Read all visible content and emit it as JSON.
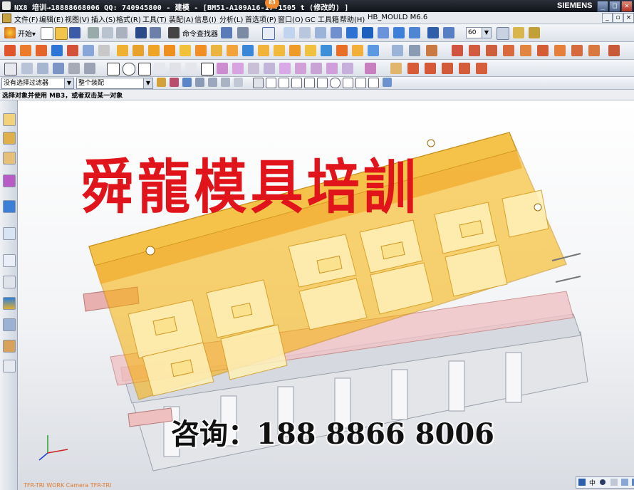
{
  "window": {
    "title": "NX8 培训→18888668006 QQ: 740945800 - 建模 - [BM51-A109A16-17-1505 t  (修改的) ]",
    "badge": "83",
    "brand": "SIEMENS",
    "buttons": [
      "_",
      "□",
      "×"
    ]
  },
  "menu": {
    "items": [
      "文件(F)",
      "编辑(E)",
      "视图(V)",
      "插入(S)",
      "格式(R)",
      "工具(T)",
      "装配(A)",
      "信息(I)",
      "分析(L)",
      "首选项(P)",
      "窗口(O)",
      "GC 工具箱",
      "帮助(H)",
      "HB_MOULD M6.6"
    ]
  },
  "toolbar": {
    "start_label": "开始▾",
    "command_finder_label": "命令查找器",
    "zoom_value": "60"
  },
  "selection": {
    "filter_value": "没有选择过滤器",
    "scope_value": "整个装配"
  },
  "cue_line": "选择对象并使用 MB3，或者双击某一对象",
  "viewport": {
    "watermark_text": "舜龍模具培訓",
    "contact_text": "咨询：188 8866 8006",
    "view_label": "TFR-TRI WORK Camera TFR-TRI"
  },
  "mini_toolbar": {
    "label": "中"
  },
  "colors": {
    "accent": "#e0141a",
    "plate": "#f7b000",
    "titlebar": "#1b1f27",
    "viewport_bg": "#f3f4f6"
  }
}
